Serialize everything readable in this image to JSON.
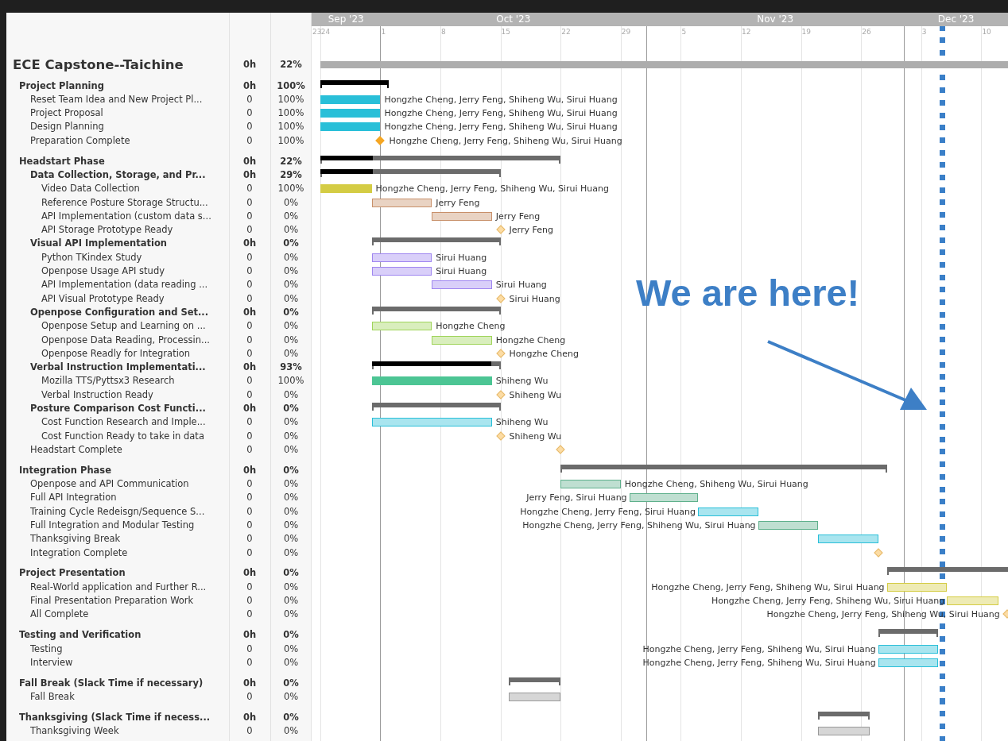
{
  "timeline": {
    "months": [
      {
        "label": "Sep '23"
      },
      {
        "label": "Oct '23"
      },
      {
        "label": "Nov '23"
      },
      {
        "label": "Dec '23"
      }
    ],
    "ticks": [
      {
        "label": "23"
      },
      {
        "label": "24"
      },
      {
        "label": "1"
      },
      {
        "label": "8"
      },
      {
        "label": "15"
      },
      {
        "label": "22"
      },
      {
        "label": "29"
      },
      {
        "label": "5"
      },
      {
        "label": "12"
      },
      {
        "label": "19"
      },
      {
        "label": "26"
      },
      {
        "label": "3"
      },
      {
        "label": "10"
      }
    ]
  },
  "project": {
    "name": "ECE Capstone--Taichine",
    "hours": "0h",
    "progress": "22%",
    "kind": "project",
    "children": [
      {
        "name": "Project Planning",
        "hours": "0h",
        "progress": "100%",
        "kind": "summary",
        "level": 1,
        "children": [
          {
            "name": "Reset Team Idea and New Project Pl...",
            "hours": "0",
            "progress": "100%",
            "kind": "task",
            "done": true,
            "color": "#29bfd8",
            "assignees": "Hongzhe Cheng, Jerry Feng, Shiheng Wu, Sirui Huang"
          },
          {
            "name": "Project Proposal",
            "hours": "0",
            "progress": "100%",
            "kind": "task",
            "done": true,
            "color": "#29bfd8",
            "assignees": "Hongzhe Cheng, Jerry Feng, Shiheng Wu, Sirui Huang"
          },
          {
            "name": "Design Planning",
            "hours": "0",
            "progress": "100%",
            "kind": "task",
            "done": true,
            "color": "#29bfd8",
            "assignees": "Hongzhe Cheng, Jerry Feng, Shiheng Wu, Sirui Huang"
          },
          {
            "name": "Preparation Complete",
            "hours": "0",
            "progress": "100%",
            "kind": "milestone",
            "done": true,
            "assignees": "Hongzhe Cheng, Jerry Feng, Shiheng Wu, Sirui Huang"
          }
        ]
      },
      {
        "name": "Headstart Phase",
        "hours": "0h",
        "progress": "22%",
        "kind": "summary",
        "level": 0.22,
        "children": [
          {
            "name": "Data Collection, Storage, and Pr...",
            "hours": "0h",
            "progress": "29%",
            "kind": "summary",
            "level": 0.29,
            "children": [
              {
                "name": "Video Data Collection",
                "hours": "0",
                "progress": "100%",
                "kind": "task",
                "done": true,
                "color": "#d4cc44",
                "assignees": "Hongzhe Cheng, Jerry Feng, Shiheng Wu, Sirui Huang"
              },
              {
                "name": "Reference Posture Storage Structu...",
                "hours": "0",
                "progress": "0%",
                "kind": "task",
                "done": false,
                "color": "#c8906a",
                "assignees": "Jerry Feng"
              },
              {
                "name": "API Implementation (custom data s...",
                "hours": "0",
                "progress": "0%",
                "kind": "task",
                "done": false,
                "color": "#c8906a",
                "assignees": "Jerry Feng"
              },
              {
                "name": "API Storage Prototype Ready",
                "hours": "0",
                "progress": "0%",
                "kind": "milestone",
                "done": false,
                "assignees": "Jerry Feng"
              }
            ]
          },
          {
            "name": "Visual API Implementation",
            "hours": "0h",
            "progress": "0%",
            "kind": "summary",
            "level": 0,
            "children": [
              {
                "name": "Python TKindex Study",
                "hours": "0",
                "progress": "0%",
                "kind": "task",
                "done": false,
                "color": "#9f86f0",
                "assignees": "Sirui Huang"
              },
              {
                "name": "Openpose Usage API study",
                "hours": "0",
                "progress": "0%",
                "kind": "task",
                "done": false,
                "color": "#9f86f0",
                "assignees": "Sirui Huang"
              },
              {
                "name": "API Implementation (data reading ...",
                "hours": "0",
                "progress": "0%",
                "kind": "task",
                "done": false,
                "color": "#9f86f0",
                "assignees": "Sirui Huang"
              },
              {
                "name": "API Visual Prototype Ready",
                "hours": "0",
                "progress": "0%",
                "kind": "milestone",
                "done": false,
                "assignees": "Sirui Huang"
              }
            ]
          },
          {
            "name": "Openpose Configuration and Set...",
            "hours": "0h",
            "progress": "0%",
            "kind": "summary",
            "level": 0,
            "children": [
              {
                "name": "Openpose Setup and Learning on ...",
                "hours": "0",
                "progress": "0%",
                "kind": "task",
                "done": false,
                "color": "#9fd45a",
                "assignees": "Hongzhe Cheng"
              },
              {
                "name": "Openpose Data Reading, Processin...",
                "hours": "0",
                "progress": "0%",
                "kind": "task",
                "done": false,
                "color": "#9fd45a",
                "assignees": "Hongzhe Cheng"
              },
              {
                "name": "Openpose Readly for Integration",
                "hours": "0",
                "progress": "0%",
                "kind": "milestone",
                "done": false,
                "assignees": "Hongzhe Cheng"
              }
            ]
          },
          {
            "name": "Verbal Instruction Implementati...",
            "hours": "0h",
            "progress": "93%",
            "kind": "summary",
            "level": 0.93,
            "children": [
              {
                "name": "Mozilla TTS/Pyttsx3 Research",
                "hours": "0",
                "progress": "100%",
                "kind": "task",
                "done": true,
                "color": "#4cc594",
                "assignees": "Shiheng Wu"
              },
              {
                "name": "Verbal Instruction Ready",
                "hours": "0",
                "progress": "0%",
                "kind": "milestone",
                "done": false,
                "assignees": "Shiheng Wu"
              }
            ]
          },
          {
            "name": "Posture Comparison Cost Functi...",
            "hours": "0h",
            "progress": "0%",
            "kind": "summary",
            "level": 0,
            "children": [
              {
                "name": "Cost Function Research and Imple...",
                "hours": "0",
                "progress": "0%",
                "kind": "task",
                "done": false,
                "color": "#29bfd8",
                "assignees": "Shiheng Wu"
              },
              {
                "name": "Cost Function Ready to take in data",
                "hours": "0",
                "progress": "0%",
                "kind": "milestone",
                "done": false,
                "assignees": "Shiheng Wu"
              }
            ]
          },
          {
            "name": "Headstart Complete",
            "hours": "0",
            "progress": "0%",
            "kind": "milestone",
            "done": false
          }
        ]
      },
      {
        "name": "Integration Phase",
        "hours": "0h",
        "progress": "0%",
        "kind": "summary",
        "level": 0,
        "children": [
          {
            "name": "Openpose and API Communication",
            "hours": "0",
            "progress": "0%",
            "kind": "task",
            "done": false,
            "color": "#5fb08c",
            "assignees": "Hongzhe Cheng, Shiheng Wu, Sirui Huang"
          },
          {
            "name": "Full API Integration",
            "hours": "0",
            "progress": "0%",
            "kind": "task",
            "done": false,
            "color": "#5fb08c",
            "assignees": "Jerry Feng, Sirui Huang"
          },
          {
            "name": "Training Cycle Redeisgn/Sequence S...",
            "hours": "0",
            "progress": "0%",
            "kind": "task",
            "done": false,
            "color": "#29bfd8",
            "assignees": "Hongzhe Cheng, Jerry Feng, Sirui Huang"
          },
          {
            "name": "Full Integration and Modular Testing",
            "hours": "0",
            "progress": "0%",
            "kind": "task",
            "done": false,
            "color": "#5fb08c",
            "assignees": "Hongzhe Cheng, Jerry Feng, Shiheng Wu, Sirui Huang"
          },
          {
            "name": "Thanksgiving Break",
            "hours": "0",
            "progress": "0%",
            "kind": "task",
            "done": false,
            "color": "#29bfd8"
          },
          {
            "name": "Integration Complete",
            "hours": "0",
            "progress": "0%",
            "kind": "milestone",
            "done": false
          }
        ]
      },
      {
        "name": "Project Presentation",
        "hours": "0h",
        "progress": "0%",
        "kind": "summary",
        "level": 0,
        "children": [
          {
            "name": "Real-World application and Further R...",
            "hours": "0",
            "progress": "0%",
            "kind": "task",
            "done": false,
            "color": "#d4cc44",
            "assignees": "Hongzhe Cheng, Jerry Feng, Shiheng Wu, Sirui Huang"
          },
          {
            "name": "Final Presentation Preparation Work",
            "hours": "0",
            "progress": "0%",
            "kind": "task",
            "done": false,
            "color": "#d4cc44",
            "assignees": "Hongzhe Cheng, Jerry Feng, Shiheng Wu, Sirui Huang"
          },
          {
            "name": "All Complete",
            "hours": "0",
            "progress": "0%",
            "kind": "milestone",
            "done": false,
            "assignees": "Hongzhe Cheng, Jerry Feng, Shiheng Wu, Sirui Huang"
          }
        ]
      },
      {
        "name": "Testing and Verification",
        "hours": "0h",
        "progress": "0%",
        "kind": "summary",
        "level": 0,
        "children": [
          {
            "name": "Testing",
            "hours": "0",
            "progress": "0%",
            "kind": "task",
            "done": false,
            "color": "#29bfd8",
            "assignees": "Hongzhe Cheng, Jerry Feng, Shiheng Wu, Sirui Huang"
          },
          {
            "name": "Interview",
            "hours": "0",
            "progress": "0%",
            "kind": "task",
            "done": false,
            "color": "#29bfd8",
            "assignees": "Hongzhe Cheng, Jerry Feng, Shiheng Wu, Sirui Huang"
          }
        ]
      },
      {
        "name": "Fall Break (Slack Time if necessary)",
        "hours": "0h",
        "progress": "0%",
        "kind": "summary",
        "level": 0,
        "children": [
          {
            "name": "Fall Break",
            "hours": "0",
            "progress": "0%",
            "kind": "task",
            "done": false,
            "color": "#999999"
          }
        ]
      },
      {
        "name": "Thanksgiving (Slack Time if necess...",
        "hours": "0h",
        "progress": "0%",
        "kind": "summary",
        "level": 0,
        "children": [
          {
            "name": "Thanksgiving Week",
            "hours": "0",
            "progress": "0%",
            "kind": "task",
            "done": false,
            "color": "#999999"
          }
        ]
      }
    ]
  },
  "annotation": {
    "text": "We are here!"
  }
}
